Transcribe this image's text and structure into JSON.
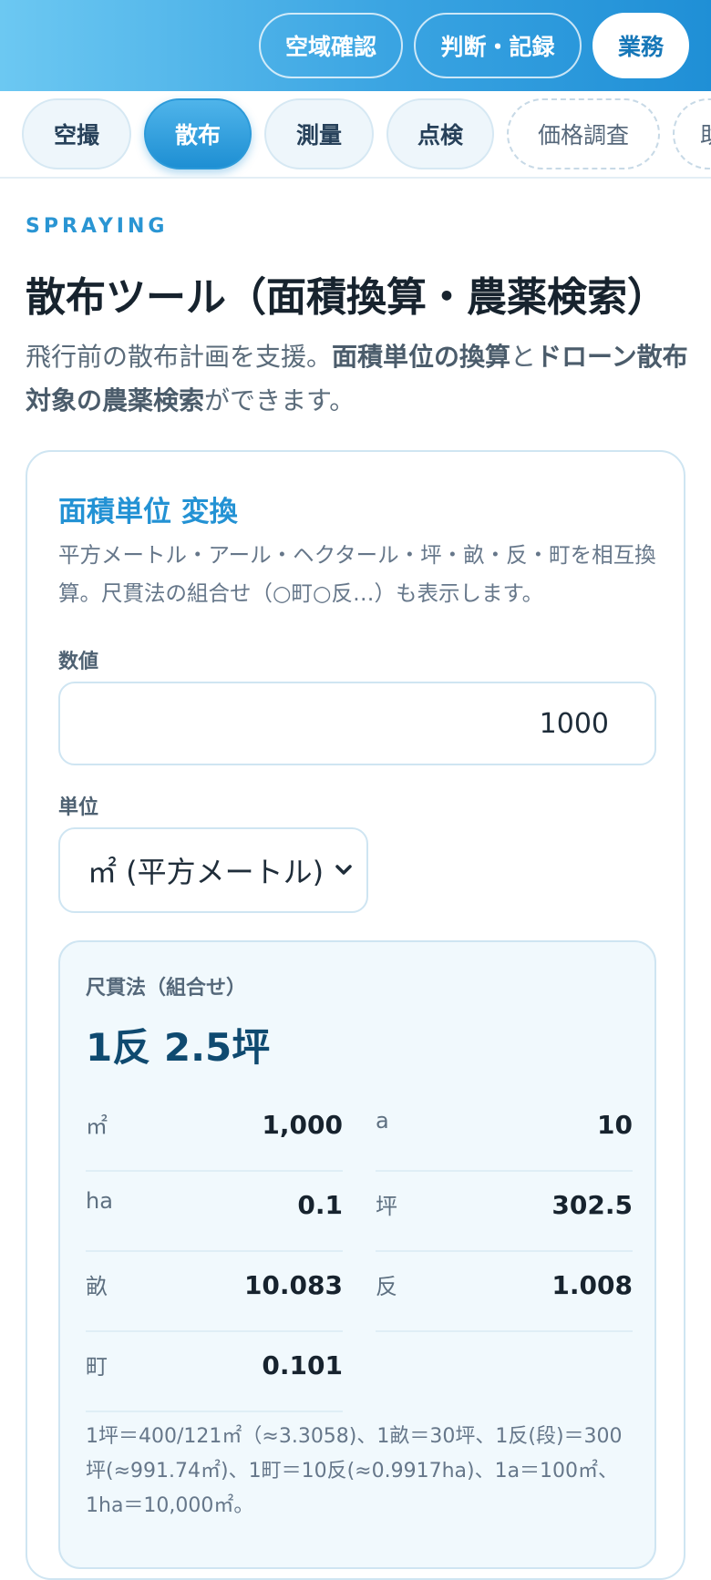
{
  "header": {
    "buttons": [
      {
        "label": "空域確認",
        "active": false
      },
      {
        "label": "判断・記録",
        "active": false
      },
      {
        "label": "業務",
        "active": true
      }
    ]
  },
  "tabs": [
    {
      "label": "空撮",
      "state": "normal"
    },
    {
      "label": "散布",
      "state": "active"
    },
    {
      "label": "測量",
      "state": "normal"
    },
    {
      "label": "点検",
      "state": "normal"
    },
    {
      "label": "価格調査",
      "state": "dashed"
    },
    {
      "label": "助",
      "state": "dashed"
    }
  ],
  "page": {
    "eyebrow": "SPRAYING",
    "title": "散布ツール（面積換算・農薬検索）",
    "lead_1": "飛行前の散布計画を支援。",
    "lead_bold_1": "面積単位の換算",
    "lead_2": "と",
    "lead_bold_2": "ドローン散布対象の農薬検索",
    "lead_3": "ができます。"
  },
  "converter": {
    "title": "面積単位 変換",
    "description": "平方メートル・アール・ヘクタール・坪・畝・反・町を相互換算。尺貫法の組合せ（○町○反…）も表示します。",
    "value_label": "数値",
    "value": "1000",
    "unit_label": "単位",
    "unit_selected": "㎡ (平方メートル)",
    "result": {
      "combo_label": "尺貫法（組合せ）",
      "combo_value": "1反 2.5坪",
      "rows": [
        {
          "unit": "㎡",
          "value": "1,000"
        },
        {
          "unit": "a",
          "value": "10"
        },
        {
          "unit": "ha",
          "value": "0.1"
        },
        {
          "unit": "坪",
          "value": "302.5"
        },
        {
          "unit": "畝",
          "value": "10.083"
        },
        {
          "unit": "反",
          "value": "1.008"
        },
        {
          "unit": "町",
          "value": "0.101"
        }
      ],
      "note": "1坪＝400/121㎡（≈3.3058)、1畝＝30坪、1反(段)＝300坪(≈991.74㎡)、1町＝10反(≈0.9917ha)、1a＝100㎡、1ha＝10,000㎡。"
    }
  },
  "colors": {
    "accent": "#2392d4",
    "header_gradient_start": "#6cc8f2",
    "header_gradient_end": "#1f8fd6",
    "result_bg": "#f1f9fd",
    "combo_value": "#0f4a70"
  },
  "icons": {
    "select_arrow": "chevron-down-icon"
  }
}
